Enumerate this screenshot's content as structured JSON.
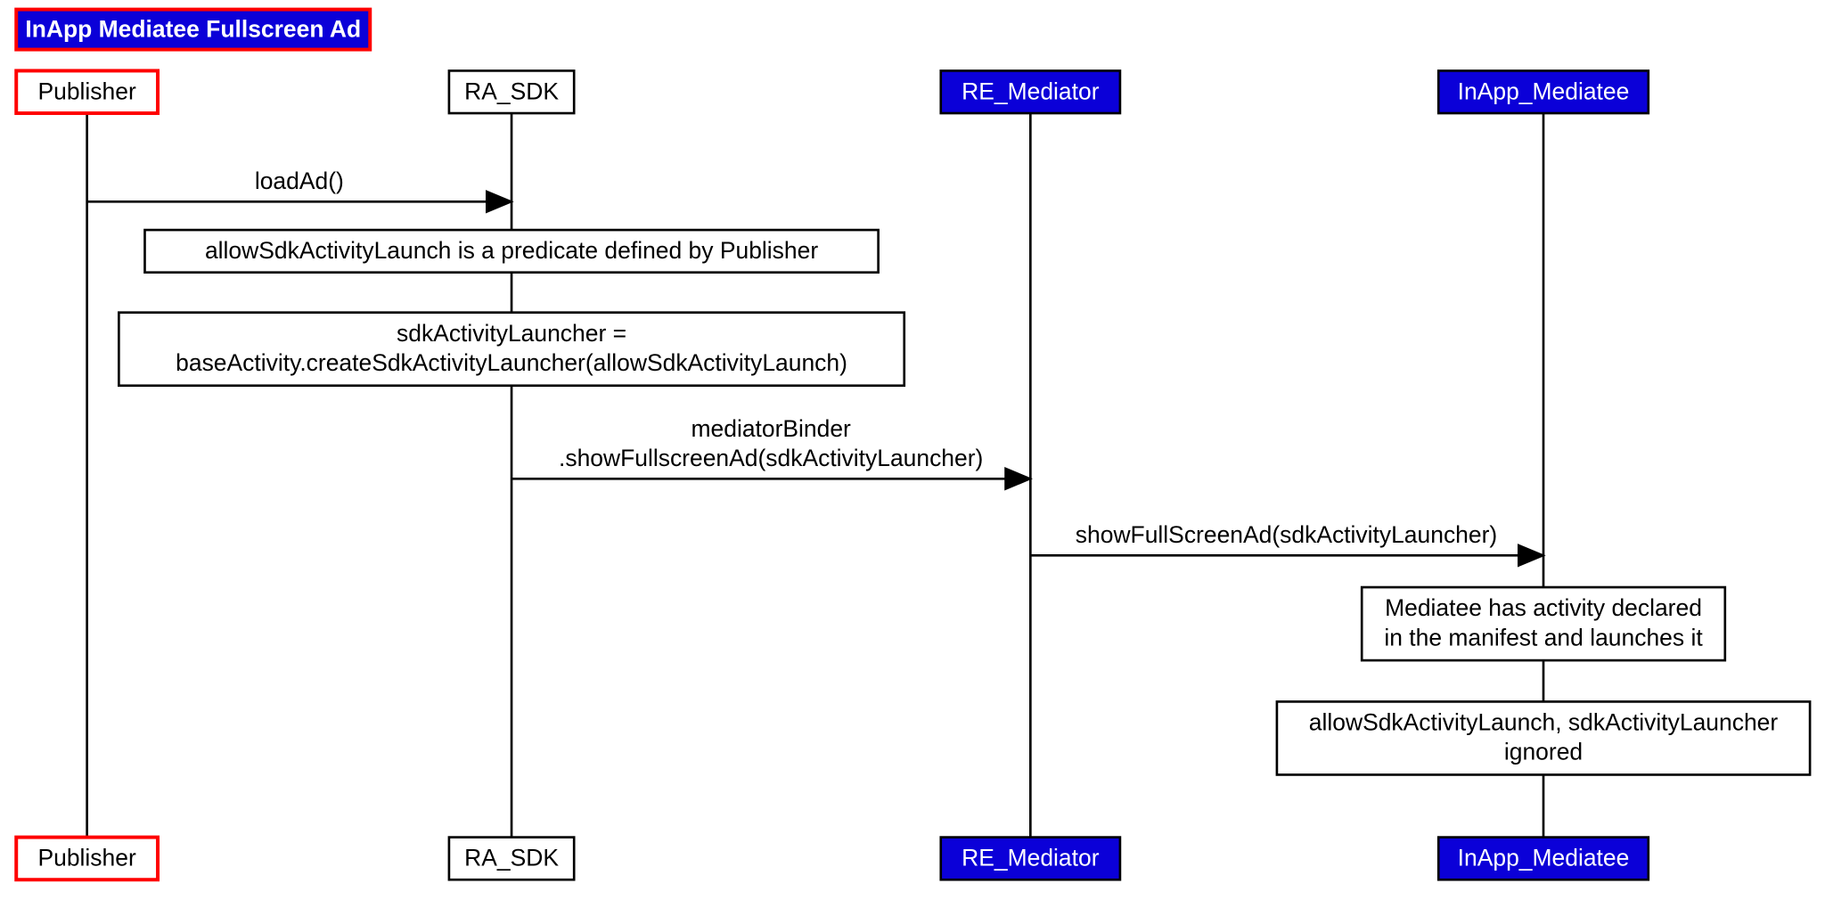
{
  "title": "InApp Mediatee Fullscreen Ad",
  "participants": {
    "publisher": "Publisher",
    "ra_sdk": "RA_SDK",
    "re_mediator": "RE_Mediator",
    "inapp_mediatee": "InApp_Mediatee"
  },
  "messages": {
    "loadAd": "loadAd()",
    "mediatorBinder1": "mediatorBinder",
    "mediatorBinder2": ".showFullscreenAd(sdkActivityLauncher)",
    "showFullScreenAd": "showFullScreenAd(sdkActivityLauncher)"
  },
  "notes": {
    "predicate": "allowSdkActivityLaunch is a predicate defined by Publisher",
    "launcher1": "sdkActivityLauncher =",
    "launcher2": "baseActivity.createSdkActivityLauncher(allowSdkActivityLaunch)",
    "manifest1": "Mediatee has activity declared",
    "manifest2": "in the manifest and launches it",
    "ignored1": "allowSdkActivityLaunch, sdkActivityLauncher",
    "ignored2": "ignored"
  }
}
